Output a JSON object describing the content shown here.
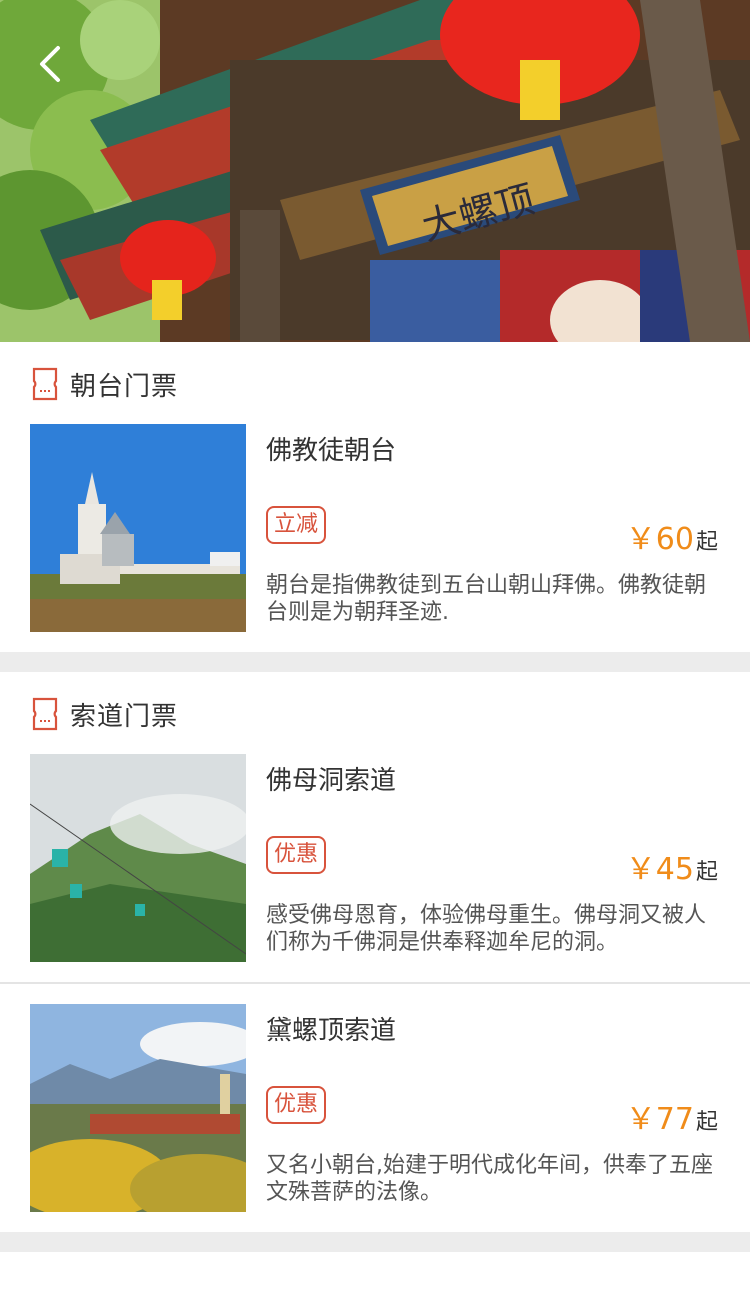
{
  "hero": {
    "plaque_text": "大螺顶",
    "back_icon": "chevron-left-icon"
  },
  "sections": [
    {
      "title": "朝台门票",
      "icon": "ticket-icon",
      "items": [
        {
          "name": "佛教徒朝台",
          "badge": "立减",
          "price_symbol": "￥",
          "price": "60",
          "price_suffix": "起",
          "desc": "朝台是指佛教徒到五台山朝山拜佛。佛教徒朝台则是为朝拜圣迹."
        }
      ]
    },
    {
      "title": "索道门票",
      "icon": "ticket-icon",
      "items": [
        {
          "name": "佛母洞索道",
          "badge": "优惠",
          "price_symbol": "￥",
          "price": "45",
          "price_suffix": "起",
          "desc": "感受佛母恩育，体验佛母重生。佛母洞又被人们称为千佛洞是供奉释迦牟尼的洞。"
        },
        {
          "name": "黛螺顶索道",
          "badge": "优惠",
          "price_symbol": "￥",
          "price": "77",
          "price_suffix": "起",
          "desc": "又名小朝台,始建于明代成化年间，供奉了五座文殊菩萨的法像。"
        }
      ]
    }
  ],
  "colors": {
    "accent_red": "#d8533c",
    "price_orange": "#f08c1a",
    "gap_gray": "#ececec"
  }
}
